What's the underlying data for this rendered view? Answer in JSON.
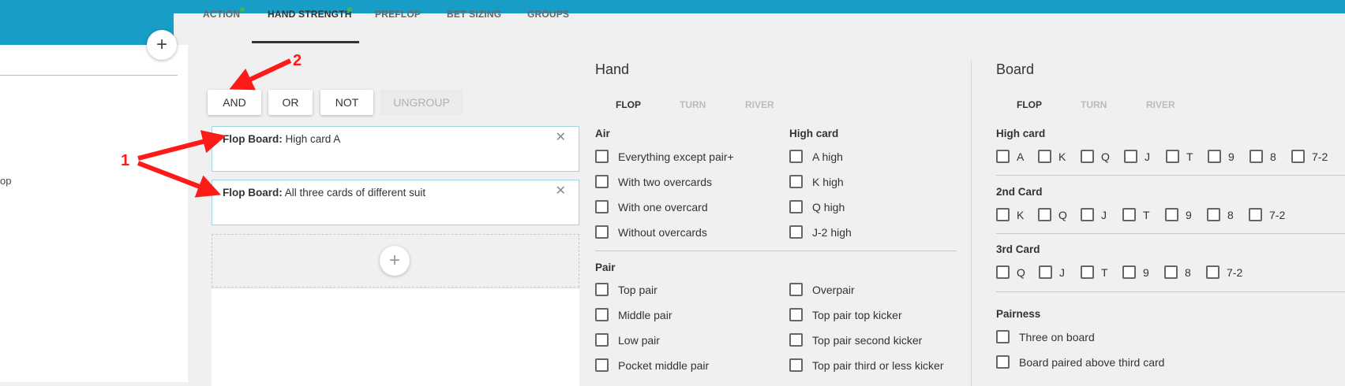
{
  "left_panel": {
    "text_fragment": "op",
    "add_icon": "plus-icon"
  },
  "tabs": [
    {
      "label": "ACTION",
      "dot": true
    },
    {
      "label": "HAND STRENGTH",
      "dot": true,
      "active": true
    },
    {
      "label": "PREFLOP"
    },
    {
      "label": "BET SIZING"
    },
    {
      "label": "GROUPS"
    }
  ],
  "logic_buttons": {
    "and": "AND",
    "or": "OR",
    "not": "NOT",
    "ungroup": "UNGROUP"
  },
  "conditions": [
    {
      "prefix": "Flop Board:",
      "text": "High card A"
    },
    {
      "prefix": "Flop Board:",
      "text": "All three cards of different suit"
    }
  ],
  "close_symbol": "✕",
  "add_symbol": "+",
  "annotations": {
    "one": "1",
    "two": "2"
  },
  "hand": {
    "title": "Hand",
    "streets": [
      "FLOP",
      "TURN",
      "RIVER"
    ],
    "air": {
      "title": "Air",
      "items": [
        "Everything except pair+",
        "With two overcards",
        "With one overcard",
        "Without overcards"
      ]
    },
    "high_card": {
      "title": "High card",
      "items": [
        "A high",
        "K high",
        "Q high",
        "J-2 high"
      ]
    },
    "pair": {
      "title": "Pair",
      "left": [
        "Top pair",
        "Middle pair",
        "Low pair",
        "Pocket middle pair"
      ],
      "right": [
        "Overpair",
        "Top pair top kicker",
        "Top pair second kicker",
        "Top pair third or less kicker"
      ]
    }
  },
  "board": {
    "title": "Board",
    "streets": [
      "FLOP",
      "TURN",
      "RIVER"
    ],
    "high_card": {
      "title": "High card",
      "items": [
        "A",
        "K",
        "Q",
        "J",
        "T",
        "9",
        "8",
        "7-2"
      ]
    },
    "second_card": {
      "title": "2nd Card",
      "items": [
        "K",
        "Q",
        "J",
        "T",
        "9",
        "8",
        "7-2"
      ]
    },
    "third_card": {
      "title": "3rd Card",
      "items": [
        "Q",
        "J",
        "T",
        "9",
        "8",
        "7-2"
      ]
    },
    "pairness": {
      "title": "Pairness",
      "items": [
        "Three on board",
        "Board paired above third card"
      ]
    }
  }
}
